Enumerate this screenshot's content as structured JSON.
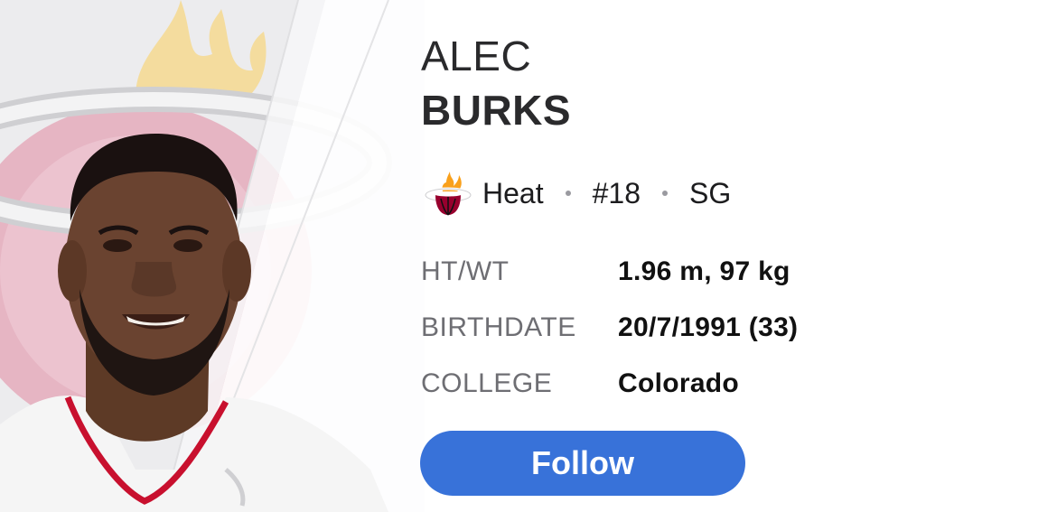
{
  "player": {
    "first_name": "ALEC",
    "last_name": "BURKS",
    "team": "Heat",
    "number": "#18",
    "position": "SG",
    "photo_icon": "player-headshot",
    "team_logo_icon": "heat-logo-icon"
  },
  "details": [
    {
      "label": "HT/WT",
      "value": "1.96 m, 97 kg"
    },
    {
      "label": "BIRTHDATE",
      "value": "20/7/1991 (33)"
    },
    {
      "label": "COLLEGE",
      "value": "Colorado"
    }
  ],
  "actions": {
    "follow_label": "Follow"
  },
  "colors": {
    "accent": "#3872d9",
    "team_primary": "#98002e",
    "team_flame": "#f9a01b"
  }
}
